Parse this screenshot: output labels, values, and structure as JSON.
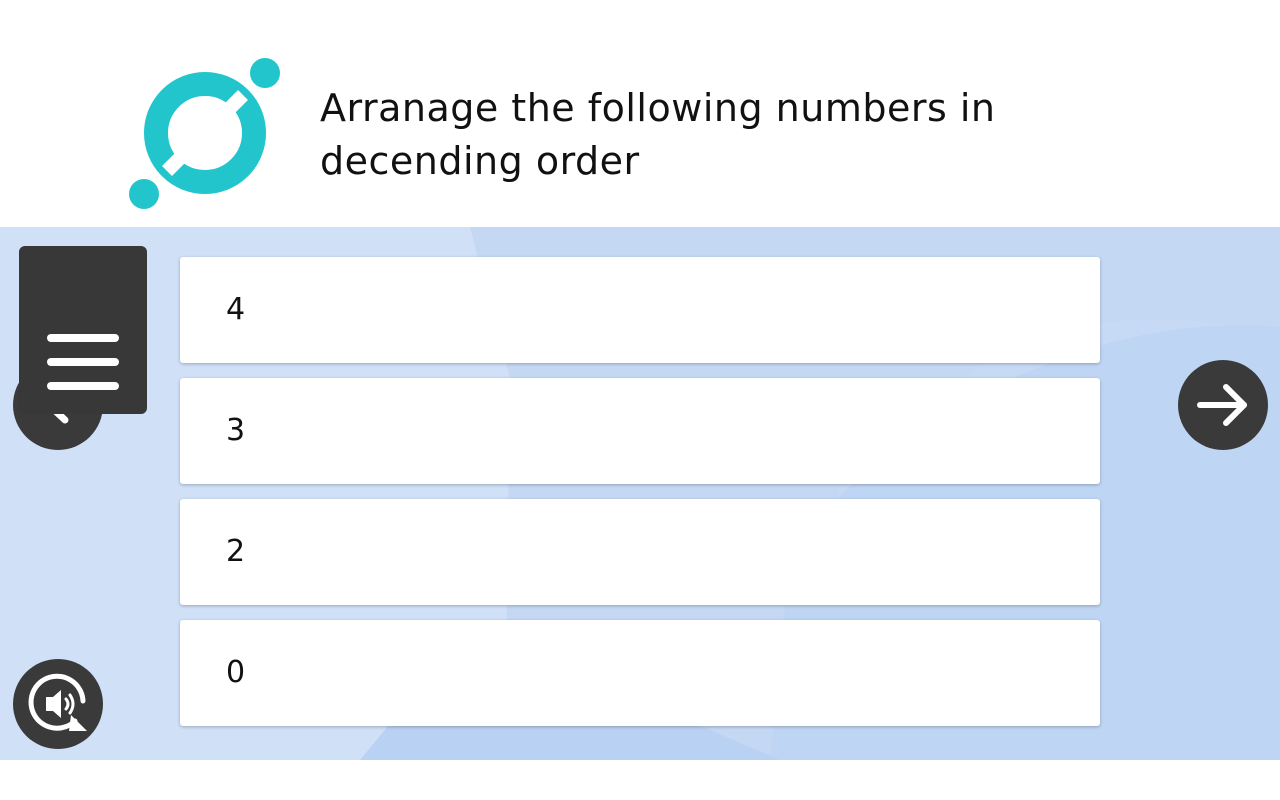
{
  "question": {
    "text": "Arranage the following numbers in decending order"
  },
  "colors": {
    "accent": "#22c5cc",
    "stage_background": "#c9dbf5",
    "button_dark": "#3a3a3a"
  },
  "options": [
    {
      "label": "4"
    },
    {
      "label": "3"
    },
    {
      "label": "2"
    },
    {
      "label": "0"
    }
  ],
  "controls": {
    "menu_icon": "hamburger-menu-icon",
    "prev_icon": "chevron-left-icon",
    "next_icon": "arrow-right-icon",
    "audio_icon": "replay-audio-icon"
  }
}
